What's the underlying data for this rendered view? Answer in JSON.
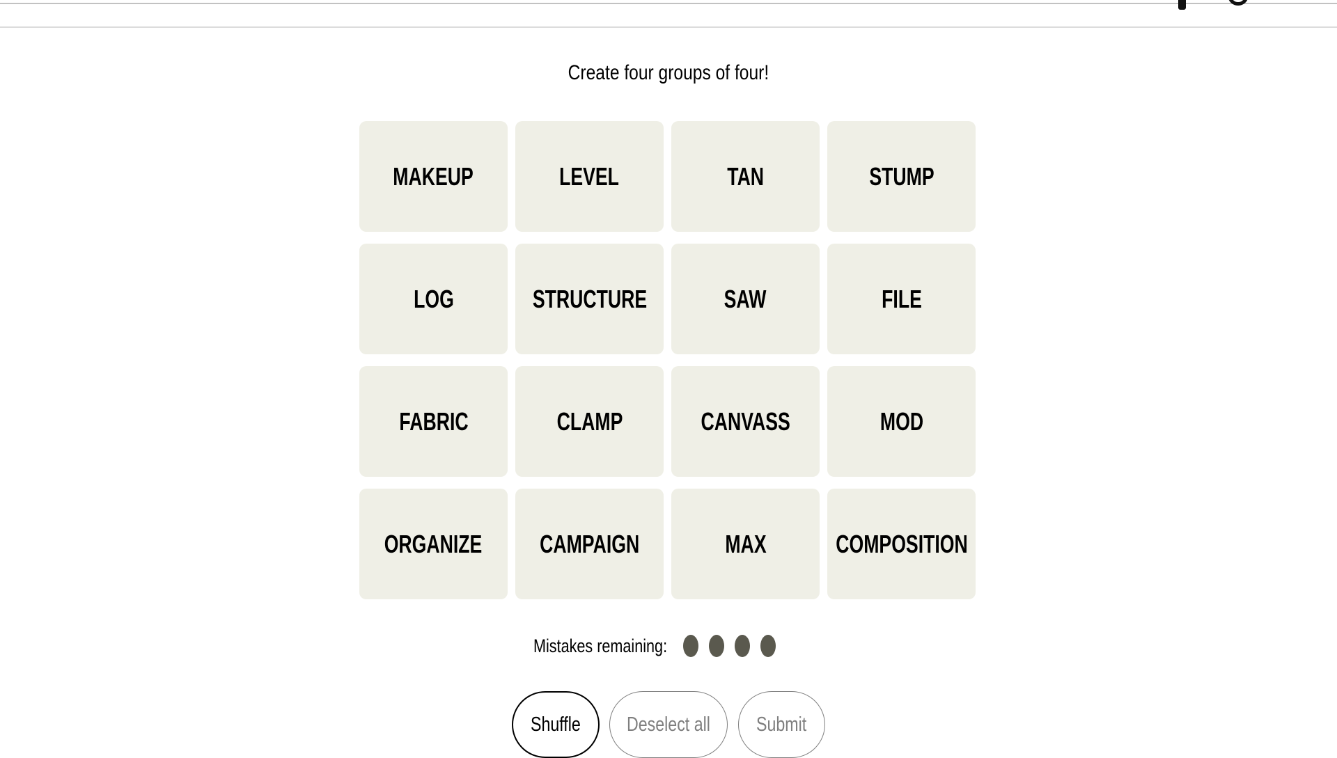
{
  "header": {
    "icons": [
      "stats-icon",
      "help-icon"
    ]
  },
  "game": {
    "instructions": "Create four groups of four!",
    "tiles": [
      "MAKEUP",
      "LEVEL",
      "TAN",
      "STUMP",
      "LOG",
      "STRUCTURE",
      "SAW",
      "FILE",
      "FABRIC",
      "CLAMP",
      "CANVASS",
      "MOD",
      "ORGANIZE",
      "CAMPAIGN",
      "MAX",
      "COMPOSITION"
    ],
    "mistakes_label": "Mistakes remaining:",
    "mistakes_remaining": 4
  },
  "controls": {
    "shuffle_label": "Shuffle",
    "deselect_label": "Deselect all",
    "submit_label": "Submit",
    "deselect_enabled": false,
    "submit_enabled": false
  },
  "colors": {
    "tile_background": "#efefe6",
    "mistake_dot": "#5a594e",
    "disabled_button": "#7f7f7f"
  }
}
